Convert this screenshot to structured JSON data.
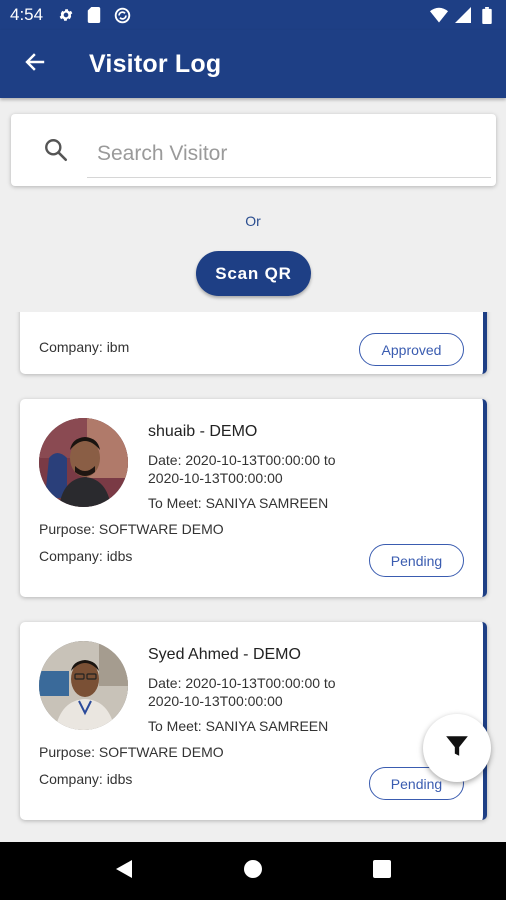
{
  "status_bar": {
    "time": "4:54",
    "left_icons": [
      "gear-icon",
      "sim-card-icon",
      "sync-icon"
    ],
    "right_icons": [
      "wifi-icon",
      "signal-icon",
      "battery-icon"
    ]
  },
  "app_bar": {
    "title": "Visitor Log",
    "back_icon": "arrow-left-icon"
  },
  "search": {
    "placeholder": "Search Visitor",
    "value": ""
  },
  "or_label": "Or",
  "scan_button_label": "Scan QR",
  "visitors": [
    {
      "purpose": "",
      "company": "Company: ibm",
      "status": "Approved"
    },
    {
      "name": "shuaib - DEMO",
      "date": "Date: 2020-10-13T00:00:00 to 2020-10-13T00:00:00",
      "to_meet": "To Meet: SANIYA SAMREEN",
      "purpose": "Purpose: SOFTWARE DEMO",
      "company": "Company: idbs",
      "status": "Pending"
    },
    {
      "name": "Syed Ahmed - DEMO",
      "date": "Date: 2020-10-13T00:00:00 to 2020-10-13T00:00:00",
      "to_meet": "To Meet: SANIYA SAMREEN",
      "purpose": "Purpose: SOFTWARE DEMO",
      "company": "Company: idbs",
      "status": "Pending"
    }
  ],
  "fab_icon": "filter-icon",
  "nav_bar": {
    "buttons": [
      "back-triangle-icon",
      "home-circle-icon",
      "recents-square-icon"
    ]
  },
  "colors": {
    "primary": "#1e3f85",
    "status_pill": "#3a5cb0",
    "background": "#efefef"
  }
}
